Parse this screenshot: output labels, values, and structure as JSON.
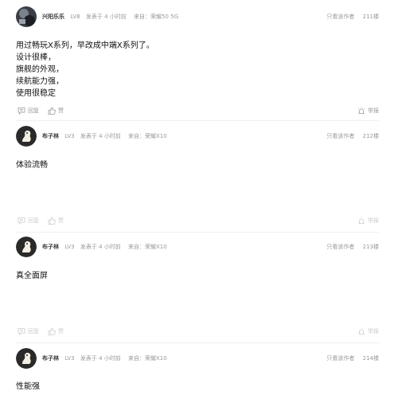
{
  "posts": [
    {
      "author": "兴阳乐乐",
      "level": "LV8",
      "time": "发表于 4 小时前",
      "source": "来自：荣耀50 5G",
      "only_author": "只看该作者",
      "floor": "211楼",
      "content": [
        "用过畅玩X系列，早改成中端X系列了。",
        "设计很棒，",
        "旗舰的外观，",
        "续航能力强，",
        "使用很稳定"
      ],
      "reply_label": "回复",
      "like_label": "赞",
      "report_label": "举报",
      "avatar": "photo-avatar"
    },
    {
      "author": "布子林",
      "level": "LV3",
      "time": "发表于 4 小时前",
      "source": "来自：荣耀X10",
      "only_author": "只看该作者",
      "floor": "212楼",
      "content": [
        "体验流畅"
      ],
      "reply_label": "回复",
      "like_label": "赞",
      "report_label": "举报",
      "avatar": "cartoon-avatar"
    },
    {
      "author": "布子林",
      "level": "LV3",
      "time": "发表于 4 小时前",
      "source": "来自：荣耀X10",
      "only_author": "只看该作者",
      "floor": "213楼",
      "content": [
        "真全面屏"
      ],
      "reply_label": "回复",
      "like_label": "赞",
      "report_label": "举报",
      "avatar": "cartoon-avatar"
    },
    {
      "author": "布子林",
      "level": "LV3",
      "time": "发表于 4 小时前",
      "source": "来自：荣耀X10",
      "only_author": "只看该作者",
      "floor": "214楼",
      "content": [
        "性能强"
      ],
      "avatar": "cartoon-avatar"
    }
  ],
  "icons": {
    "reply": "comment-icon",
    "like": "thumbs-up-icon",
    "report": "alarm-icon"
  },
  "colors": {
    "meta": "#999999",
    "content": "#111111",
    "divider": "#efefef"
  }
}
